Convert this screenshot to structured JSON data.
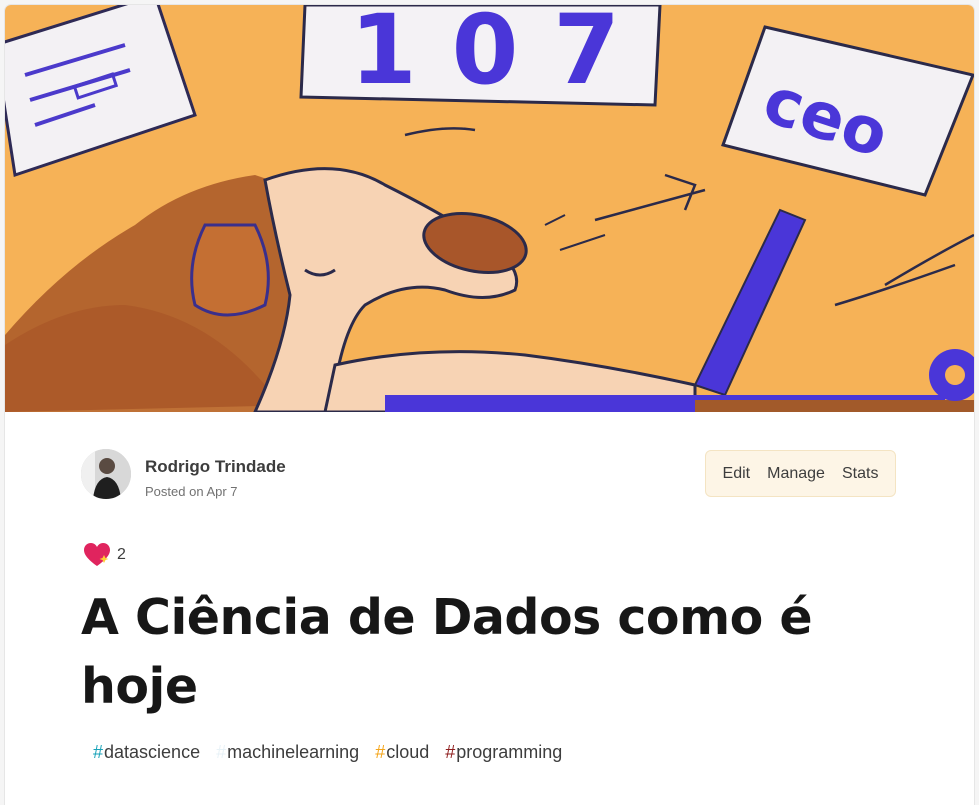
{
  "article": {
    "cover_image": "cartoon dog at laptop with data charts",
    "author": {
      "name": "Rodrigo Trindade",
      "posted": "Posted on Apr 7"
    },
    "actions": [
      "Edit",
      "Manage",
      "Stats"
    ],
    "reactions": {
      "icon": "sparkle-heart-icon",
      "count": "2"
    },
    "title": "A Ciência de Dados como é hoje",
    "tags": [
      {
        "name": "datascience",
        "hash_color": "#17a2b8"
      },
      {
        "name": "machinelearning",
        "hash_color": "#e8f2f7"
      },
      {
        "name": "cloud",
        "hash_color": "#f4a51a"
      },
      {
        "name": "programming",
        "hash_color": "#8e1c1c"
      }
    ]
  },
  "cover_art": {
    "sign_number": "107",
    "paper_text": "ceo"
  }
}
